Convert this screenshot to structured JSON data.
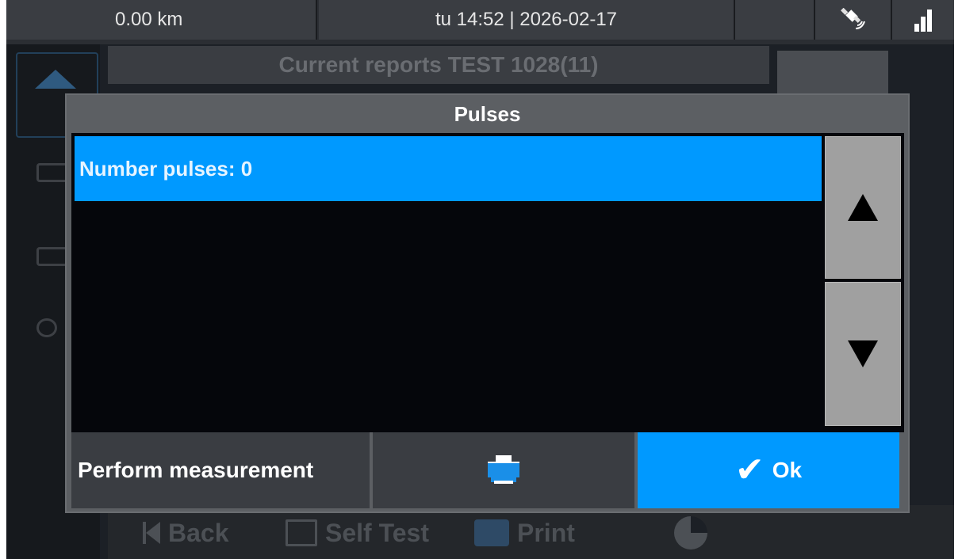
{
  "statusbar": {
    "odometer": "0.00 km",
    "datetime": "tu 14:52 | 2026-02-17",
    "gps_icon": "satellite-icon",
    "signal_icon": "signal-bars-icon"
  },
  "background": {
    "title": "Current reports TEST 1028(11)",
    "bottom_nav": {
      "back": "Back",
      "self_test": "Self Test",
      "print": "Print"
    }
  },
  "dialog": {
    "title": "Pulses",
    "list_items": [
      "Number pulses: 0"
    ],
    "buttons": {
      "measure": "Perform measurement",
      "ok": "Ok"
    }
  },
  "colors": {
    "accent": "#0099ff",
    "dialog_bg": "#5c5f63",
    "list_bg": "#05060b",
    "scroll_btn": "#a0a0a0"
  }
}
